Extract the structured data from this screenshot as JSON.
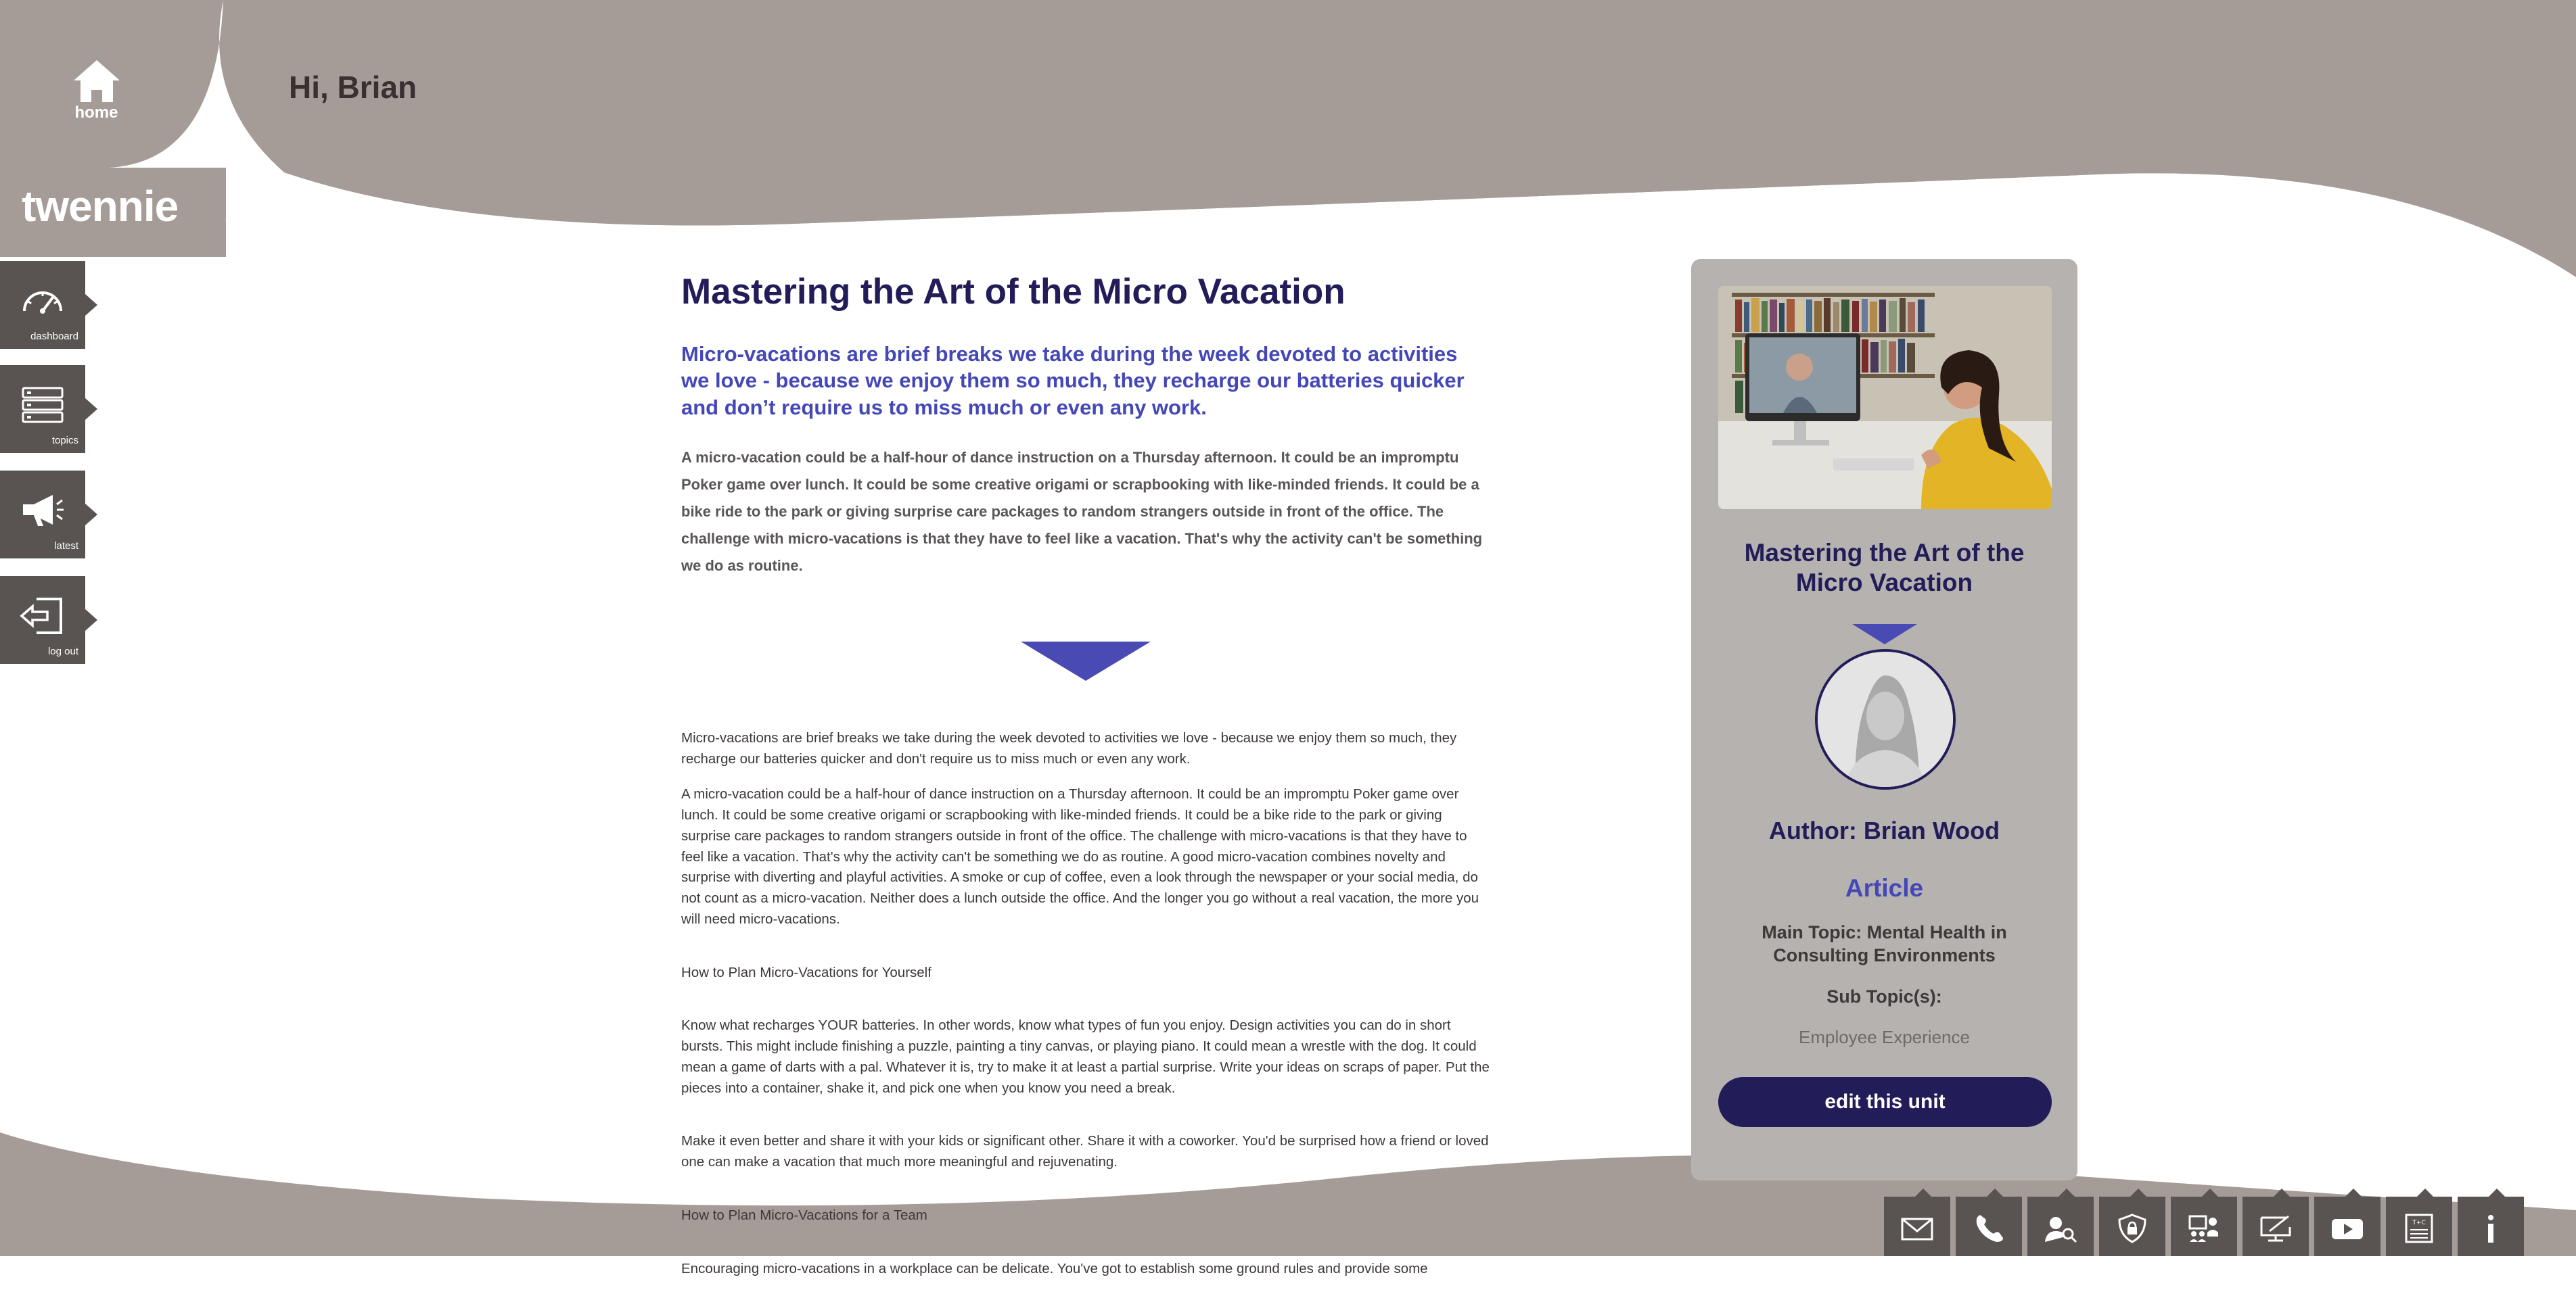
{
  "header": {
    "home_label": "home",
    "greeting": "Hi, Brian",
    "logo": "twennie"
  },
  "nav": {
    "items": [
      {
        "label": "dashboard",
        "icon": "speedometer-icon"
      },
      {
        "label": "topics",
        "icon": "server-icon"
      },
      {
        "label": "latest",
        "icon": "megaphone-icon"
      },
      {
        "label": "log out",
        "icon": "logout-icon"
      }
    ]
  },
  "article": {
    "title": "Mastering the Art of the Micro Vacation",
    "subtitle": "Micro-vacations are brief breaks we take during the week devoted to activities we love - because we enjoy them so much, they recharge our batteries quicker and don’t require us to miss much or even any work.",
    "lead": "A micro-vacation could be a half-hour of dance instruction on a Thursday afternoon. It could be an impromptu Poker game over lunch. It could be some creative origami or scrapbooking with like-minded friends. It could be a bike ride to the park or giving surprise care packages to random strangers outside in front of the office. The challenge with micro-vacations is that they have to feel like a vacation. That's why the activity can't be something we do as routine.",
    "body": [
      "Micro-vacations are brief breaks we take during the week devoted to activities we love - because we enjoy them so much, they recharge our batteries quicker and don't require us to miss much or even any work.",
      "A micro-vacation could be a half-hour of dance instruction on a Thursday afternoon. It could be an impromptu Poker game over lunch. It could be some creative origami or scrapbooking with like-minded friends. It could be a bike ride to the park or giving surprise care packages to random strangers outside in front of the office. The challenge with micro-vacations is that they have to feel like a vacation. That's why the activity can't be something we do as routine. A good micro-vacation combines novelty and surprise with diverting and playful activities. A smoke or cup of coffee, even a look through the newspaper or your social media, do not count as a micro-vacation. Neither does a lunch outside the office. And the longer you go without a real vacation, the more you will need micro-vacations.",
      "How to Plan Micro-Vacations for Yourself",
      "Know what recharges YOUR batteries. In other words, know what types of fun you enjoy. Design activities you can do in short bursts. This might include finishing a puzzle, painting a tiny canvas, or playing piano. It could mean a wrestle with the dog. It could mean a game of darts with a pal. Whatever it is, try to make it at least a partial surprise. Write your ideas on scraps of paper. Put the pieces into a container, shake it, and pick one when you know you need a break.",
      "Make it even better and share it with your kids or significant other. Share it with a coworker. You'd be surprised how a friend or loved one can make a vacation that much more meaningful and rejuvenating.",
      "How to Plan Micro-Vacations for a Team",
      "Encouraging micro-vacations in a workplace can be delicate. You've got to establish some ground rules and provide some"
    ]
  },
  "card": {
    "title": "Mastering the Art of the Micro Vacation",
    "author": "Author: Brian Wood",
    "type": "Article",
    "main_topic": "Main Topic: Mental Health in Consulting Environments",
    "sub_topics_label": "Sub Topic(s):",
    "sub_topics_value": "Employee Experience",
    "edit_label": "edit this unit"
  },
  "footer": {
    "icons": [
      "mail-icon",
      "phone-icon",
      "support-icon",
      "privacy-shield-icon",
      "team-icon",
      "monitor-icon",
      "video-icon",
      "terms-icon",
      "info-icon"
    ],
    "terms_text": "T+C"
  },
  "colors": {
    "taupe": "#a59c97",
    "dark_tab": "#595351",
    "navy": "#221d59",
    "indigo": "#4447b6",
    "card_bg": "#b5b2b0"
  }
}
